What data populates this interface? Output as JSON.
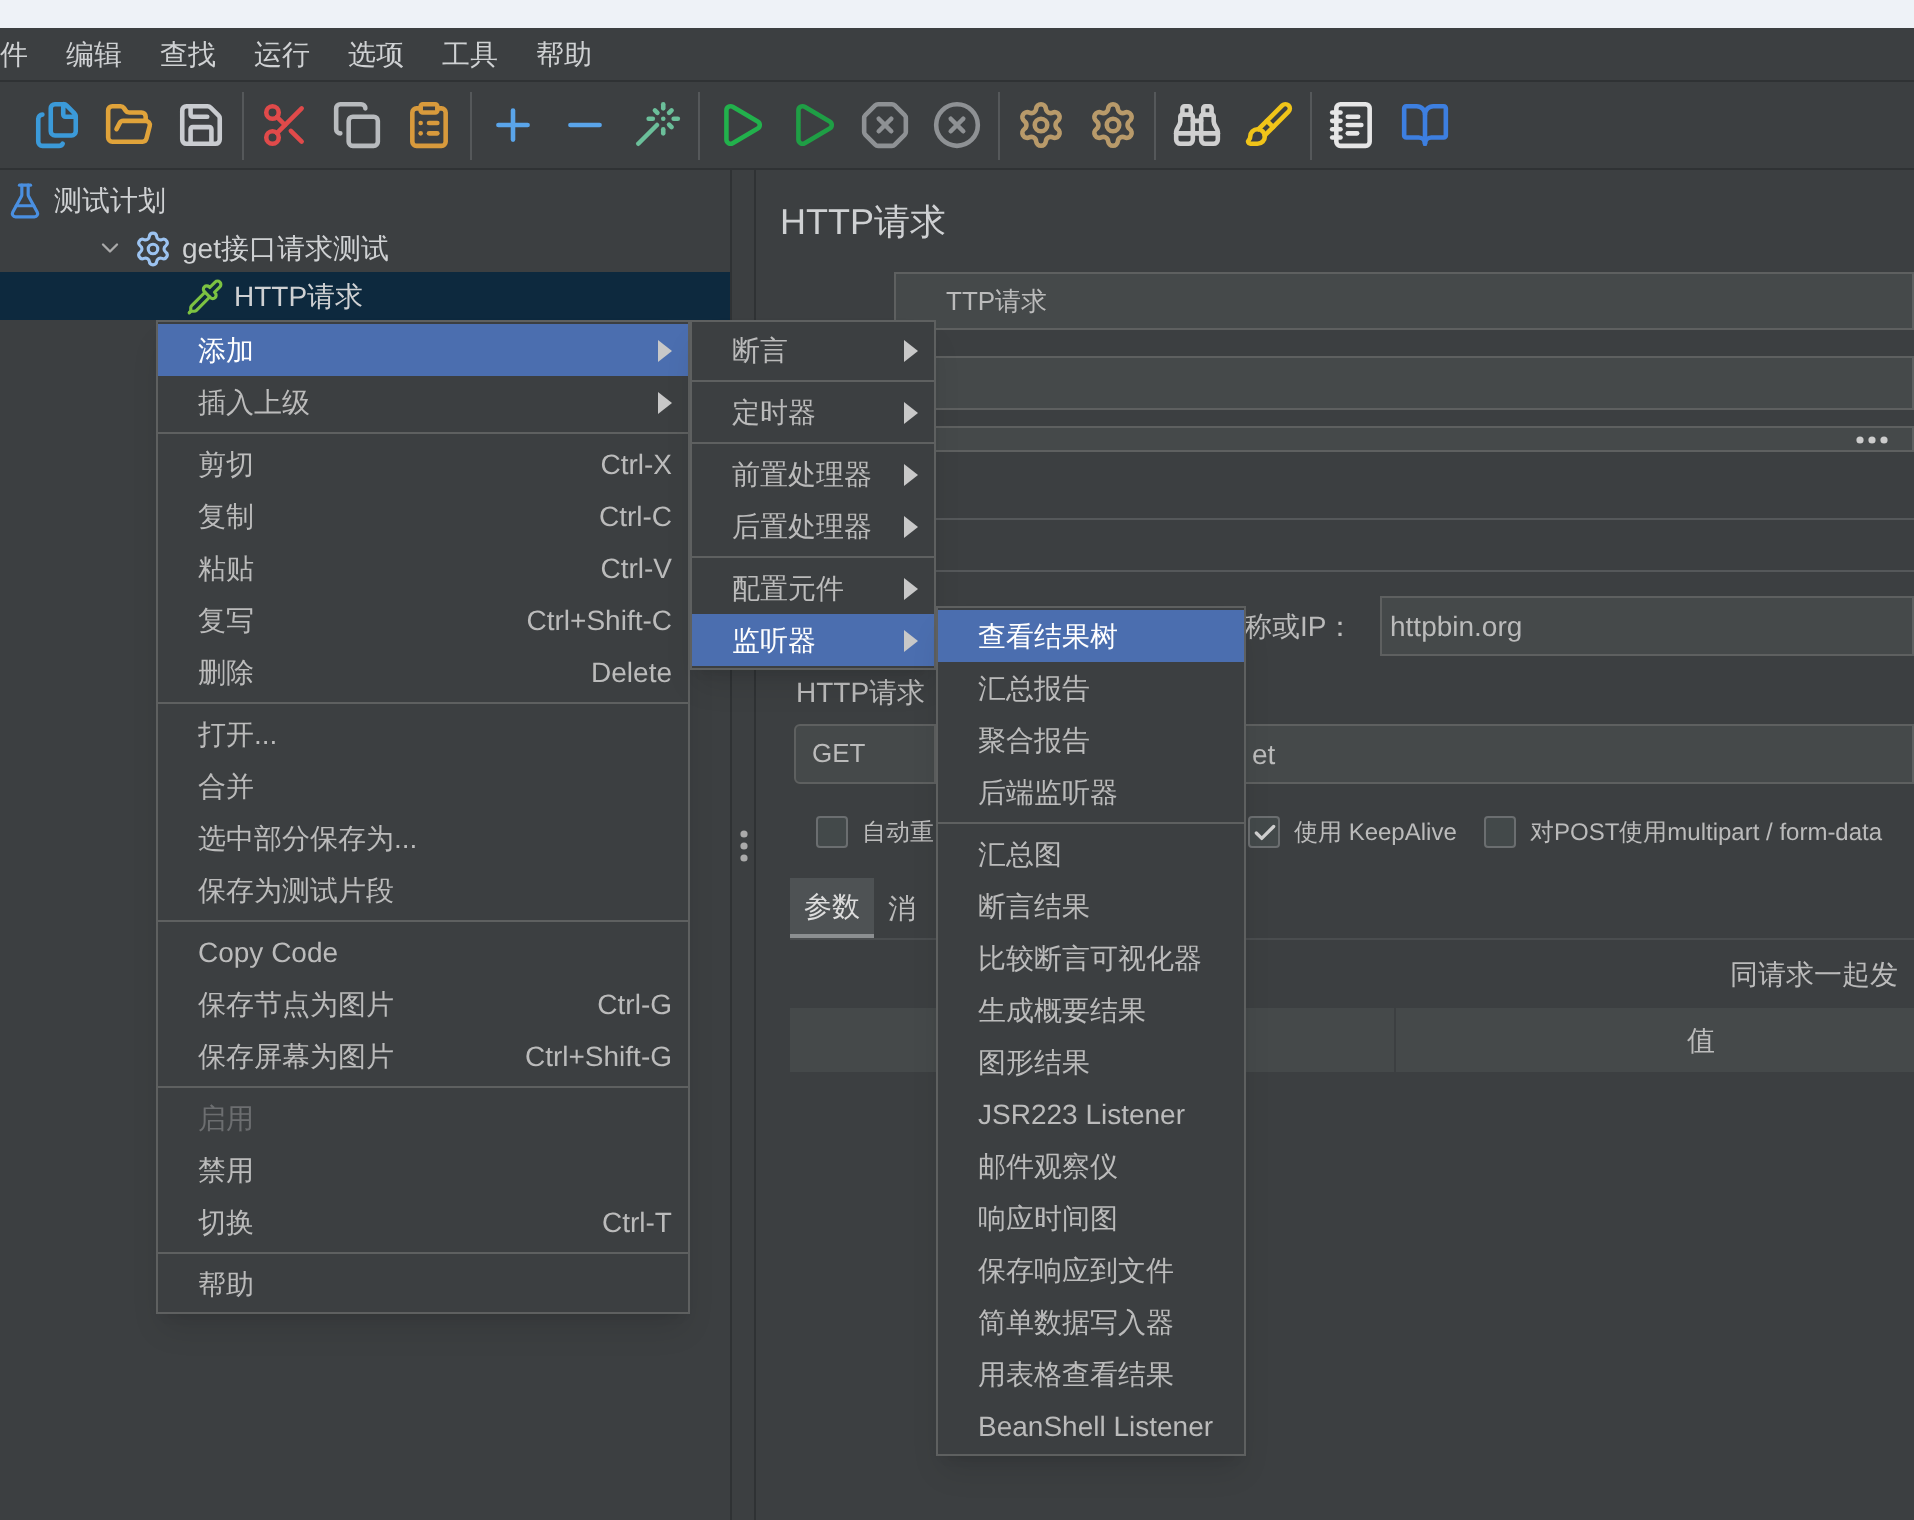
{
  "menu_bar": [
    {
      "label": "件"
    },
    {
      "label": "编辑"
    },
    {
      "label": "查找"
    },
    {
      "label": "运行"
    },
    {
      "label": "选项"
    },
    {
      "label": "工具"
    },
    {
      "label": "帮助"
    }
  ],
  "tree": [
    {
      "label": "测试计划",
      "kind": "plan",
      "selected": false,
      "children": [
        {
          "label": "get接口请求测试",
          "kind": "thread_group",
          "selected": false,
          "expanded": true,
          "children": [
            {
              "label": "HTTP请求",
              "kind": "sampler",
              "selected": true
            }
          ]
        }
      ]
    }
  ],
  "editor": {
    "title": "HTTP请求",
    "name_value": "TTP请求",
    "server_label": "称或IP：",
    "server_value": "httpbin.org",
    "group_label": "HTTP请求",
    "method": "GET",
    "path_value": "et",
    "options": [
      {
        "label": "自动重",
        "checked": false
      },
      {
        "label": "使用 KeepAlive",
        "checked": true
      },
      {
        "label": "对POST使用multipart / form-data",
        "checked": false
      }
    ],
    "tabs": [
      {
        "label": "参数",
        "selected": true
      },
      {
        "label": "消",
        "selected": false
      }
    ],
    "send_label": "同请求一起发",
    "table": {
      "columns": [
        "值"
      ]
    }
  },
  "context_menu": [
    {
      "kind": "submenu",
      "label": "添加",
      "selected": true,
      "disabled": false
    },
    {
      "kind": "submenu",
      "label": "插入上级",
      "selected": false,
      "disabled": false
    },
    {
      "kind": "separator"
    },
    {
      "kind": "item",
      "label": "剪切",
      "shortcut": "Ctrl-X",
      "selected": false,
      "disabled": false
    },
    {
      "kind": "item",
      "label": "复制",
      "shortcut": "Ctrl-C",
      "selected": false,
      "disabled": false
    },
    {
      "kind": "item",
      "label": "粘贴",
      "shortcut": "Ctrl-V",
      "selected": false,
      "disabled": false
    },
    {
      "kind": "item",
      "label": "复写",
      "shortcut": "Ctrl+Shift-C",
      "selected": false,
      "disabled": false
    },
    {
      "kind": "item",
      "label": "删除",
      "shortcut": "Delete",
      "selected": false,
      "disabled": false
    },
    {
      "kind": "separator"
    },
    {
      "kind": "item",
      "label": "打开...",
      "selected": false,
      "disabled": false
    },
    {
      "kind": "item",
      "label": "合并",
      "selected": false,
      "disabled": false
    },
    {
      "kind": "item",
      "label": "选中部分保存为...",
      "selected": false,
      "disabled": false
    },
    {
      "kind": "item",
      "label": "保存为测试片段",
      "selected": false,
      "disabled": false
    },
    {
      "kind": "separator"
    },
    {
      "kind": "item",
      "label": "Copy Code",
      "selected": false,
      "disabled": false
    },
    {
      "kind": "item",
      "label": "保存节点为图片",
      "shortcut": "Ctrl-G",
      "selected": false,
      "disabled": false
    },
    {
      "kind": "item",
      "label": "保存屏幕为图片",
      "shortcut": "Ctrl+Shift-G",
      "selected": false,
      "disabled": false
    },
    {
      "kind": "separator"
    },
    {
      "kind": "item",
      "label": "启用",
      "selected": false,
      "disabled": true
    },
    {
      "kind": "item",
      "label": "禁用",
      "selected": false,
      "disabled": false
    },
    {
      "kind": "item",
      "label": "切换",
      "shortcut": "Ctrl-T",
      "selected": false,
      "disabled": false
    },
    {
      "kind": "separator"
    },
    {
      "kind": "item",
      "label": "帮助",
      "selected": false,
      "disabled": false
    }
  ],
  "add_menu": [
    {
      "kind": "submenu",
      "label": "断言",
      "selected": false,
      "disabled": false
    },
    {
      "kind": "separator"
    },
    {
      "kind": "submenu",
      "label": "定时器",
      "selected": false,
      "disabled": false
    },
    {
      "kind": "separator"
    },
    {
      "kind": "submenu",
      "label": "前置处理器",
      "selected": false,
      "disabled": false
    },
    {
      "kind": "submenu",
      "label": "后置处理器",
      "selected": false,
      "disabled": false
    },
    {
      "kind": "separator"
    },
    {
      "kind": "submenu",
      "label": "配置元件",
      "selected": false,
      "disabled": false
    },
    {
      "kind": "submenu",
      "label": "监听器",
      "selected": true,
      "disabled": false
    }
  ],
  "listener_menu": [
    {
      "kind": "item",
      "label": "查看结果树",
      "selected": true,
      "disabled": false
    },
    {
      "kind": "item",
      "label": "汇总报告",
      "selected": false,
      "disabled": false
    },
    {
      "kind": "item",
      "label": "聚合报告",
      "selected": false,
      "disabled": false
    },
    {
      "kind": "item",
      "label": "后端监听器",
      "selected": false,
      "disabled": false
    },
    {
      "kind": "separator"
    },
    {
      "kind": "item",
      "label": "汇总图",
      "selected": false,
      "disabled": false
    },
    {
      "kind": "item",
      "label": "断言结果",
      "selected": false,
      "disabled": false
    },
    {
      "kind": "item",
      "label": "比较断言可视化器",
      "selected": false,
      "disabled": false
    },
    {
      "kind": "item",
      "label": "生成概要结果",
      "selected": false,
      "disabled": false
    },
    {
      "kind": "item",
      "label": "图形结果",
      "selected": false,
      "disabled": false
    },
    {
      "kind": "item",
      "label": "JSR223 Listener",
      "selected": false,
      "disabled": false
    },
    {
      "kind": "item",
      "label": "邮件观察仪",
      "selected": false,
      "disabled": false
    },
    {
      "kind": "item",
      "label": "响应时间图",
      "selected": false,
      "disabled": false
    },
    {
      "kind": "item",
      "label": "保存响应到文件",
      "selected": false,
      "disabled": false
    },
    {
      "kind": "item",
      "label": "简单数据写入器",
      "selected": false,
      "disabled": false
    },
    {
      "kind": "item",
      "label": "用表格查看结果",
      "selected": false,
      "disabled": false
    },
    {
      "kind": "item",
      "label": "BeanShell Listener",
      "selected": false,
      "disabled": false
    }
  ]
}
